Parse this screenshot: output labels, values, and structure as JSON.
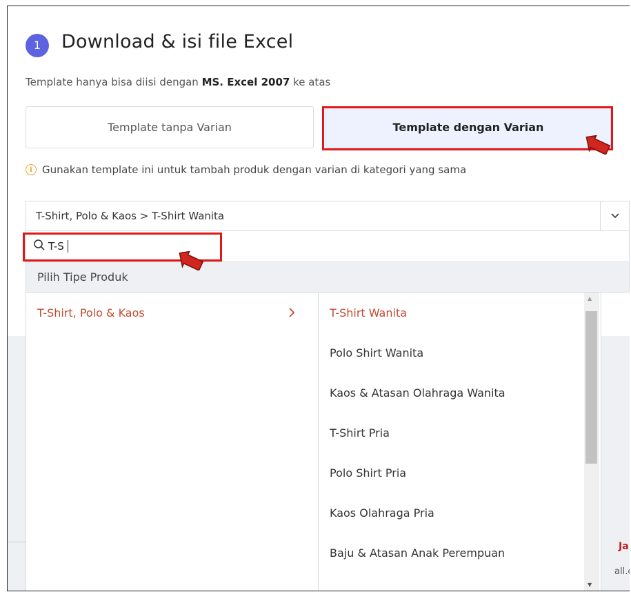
{
  "step": {
    "number": "1",
    "title": "Download & isi file Excel"
  },
  "note": {
    "prefix": "Template hanya bisa diisi dengan ",
    "bold": "MS. Excel 2007",
    "suffix": " ke atas"
  },
  "buttons": {
    "without_variant": "Template tanpa Varian",
    "with_variant": "Template dengan Varian"
  },
  "info": {
    "text": "Gunakan template ini untuk tambah produk dengan varian di kategori yang sama"
  },
  "select": {
    "value": "T-Shirt, Polo & Kaos > T-Shirt Wanita"
  },
  "search": {
    "value": "T-S"
  },
  "panel": {
    "title": "Pilih Tipe Produk"
  },
  "categories": [
    {
      "label": "T-Shirt, Polo & Kaos",
      "active": true
    }
  ],
  "subcategories": [
    {
      "label": "T-Shirt Wanita",
      "active": true
    },
    {
      "label": "Polo Shirt Wanita"
    },
    {
      "label": "Kaos & Atasan Olahraga Wanita"
    },
    {
      "label": "T-Shirt Pria"
    },
    {
      "label": "Polo Shirt Pria"
    },
    {
      "label": "Kaos Olahraga Pria"
    },
    {
      "label": "Baju & Atasan Anak Perempuan"
    }
  ],
  "background_cut": {
    "text1": "Ja",
    "text2": "all.c"
  },
  "colors": {
    "accent": "#5d63e0",
    "active_text": "#c24a31",
    "highlight": "#e11616"
  },
  "icons": {
    "search": "search-icon",
    "chevron": "chevron-down-icon",
    "info": "info-icon",
    "arrow": "chevron-right-icon"
  }
}
